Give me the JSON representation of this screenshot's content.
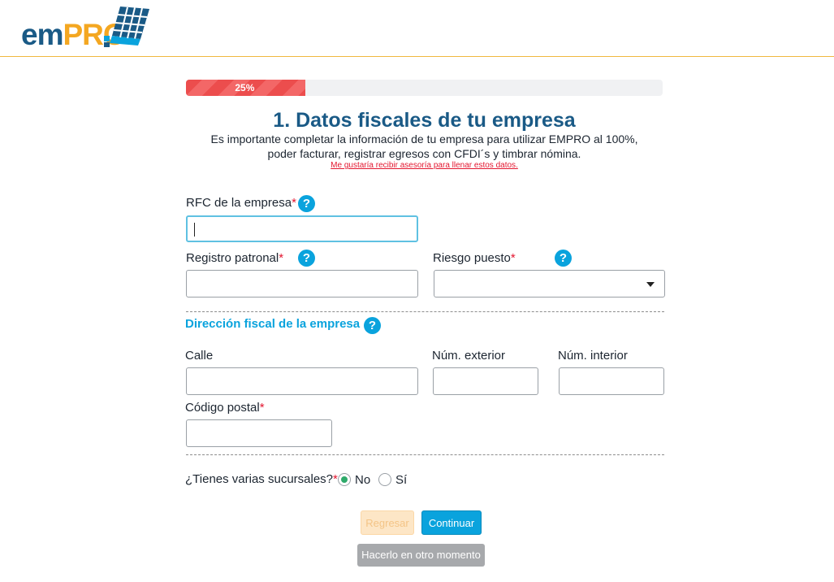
{
  "brand": {
    "logo_em": "em",
    "logo_pro": "PRO",
    "accent": "#f4a721",
    "primary": "#1a5a86"
  },
  "progress": {
    "percent": 25,
    "label": "25%",
    "color": "#ec4d4d"
  },
  "header": {
    "title": "1. Datos fiscales de tu empresa",
    "subtitle_line1": "Es importante completar la información de tu empresa para utilizar EMPRO al 100%,",
    "subtitle_line2": "poder facturar, registrar egresos con CFDI´s y timbrar nómina.",
    "advice_link": "Me gustaría recibir asesoría para llenar estos datos."
  },
  "fields": {
    "rfc": {
      "label": "RFC de la empresa",
      "required": "*",
      "value": ""
    },
    "registro": {
      "label": "Registro patronal",
      "required": "*",
      "value": ""
    },
    "riesgo": {
      "label": "Riesgo puesto",
      "required": "*",
      "selected": ""
    }
  },
  "address": {
    "section_title": "Dirección fiscal de la empresa",
    "calle": {
      "label": "Calle",
      "value": ""
    },
    "num_exterior": {
      "label": "Núm. exterior",
      "value": ""
    },
    "num_interior": {
      "label": "Núm. interior",
      "value": ""
    },
    "codigo_postal": {
      "label": "Código postal",
      "required": "*",
      "value": ""
    }
  },
  "branches": {
    "question": "¿Tienes varias sucursales?",
    "required": "*",
    "options": [
      {
        "label": "No",
        "checked": true
      },
      {
        "label": "Sí",
        "checked": false
      }
    ]
  },
  "buttons": {
    "back": "Regresar",
    "next": "Continuar",
    "later": "Hacerlo en otro momento"
  },
  "icons": {
    "help": "question-circle-icon",
    "dropdown": "chevron-down-icon"
  },
  "help_glyph": "?"
}
